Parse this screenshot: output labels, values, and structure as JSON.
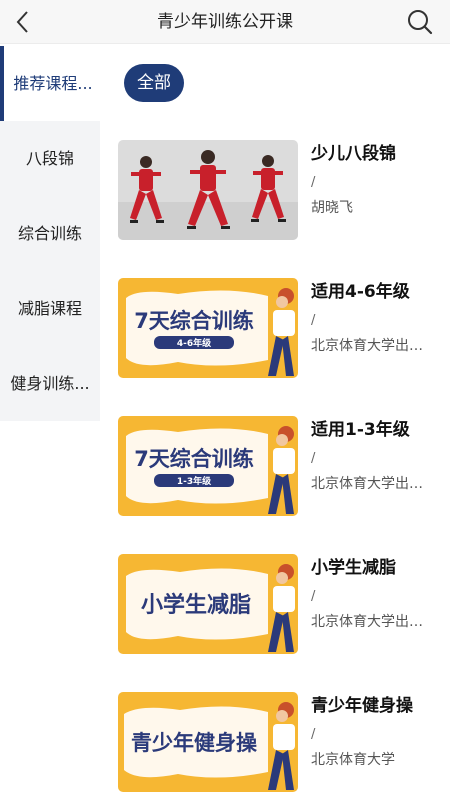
{
  "header": {
    "title": "青少年训练公开课",
    "back_icon": "chevron-left-icon",
    "search_icon": "search-icon"
  },
  "sidebar": {
    "items": [
      {
        "label": "推荐课程...",
        "active": true
      },
      {
        "label": "八段锦",
        "active": false
      },
      {
        "label": "综合训练",
        "active": false
      },
      {
        "label": "减脂课程",
        "active": false
      },
      {
        "label": "健身训练...",
        "active": false
      }
    ]
  },
  "filter": {
    "all_label": "全部"
  },
  "courses": [
    {
      "title": "少儿八段锦",
      "slash": "/",
      "author": "胡晓飞",
      "thumb": {
        "type": "photo",
        "bg": "#d9d9d9",
        "figure_color": "#c8202b"
      }
    },
    {
      "title": "适用4-6年级",
      "slash": "/",
      "author": "北京体育大学出…",
      "thumb": {
        "type": "banner",
        "headline": "7天综合训练",
        "sub": "4-6年级",
        "bg": "#f6b733"
      }
    },
    {
      "title": "适用1-3年级",
      "slash": "/",
      "author": "北京体育大学出…",
      "thumb": {
        "type": "banner",
        "headline": "7天综合训练",
        "sub": "1-3年级",
        "bg": "#f6b733"
      }
    },
    {
      "title": "小学生减脂",
      "slash": "/",
      "author": "北京体育大学出…",
      "thumb": {
        "type": "banner",
        "headline": "小学生减脂",
        "sub": "",
        "bg": "#f6b733"
      }
    },
    {
      "title": "青少年健身操",
      "slash": "/",
      "author": "北京体育大学",
      "thumb": {
        "type": "banner",
        "headline": "青少年健身操",
        "sub": "",
        "bg": "#f6b733"
      }
    }
  ],
  "colors": {
    "accent": "#1f3c78",
    "banner_yellow": "#f6b733",
    "banner_text": "#2b3a7a"
  }
}
